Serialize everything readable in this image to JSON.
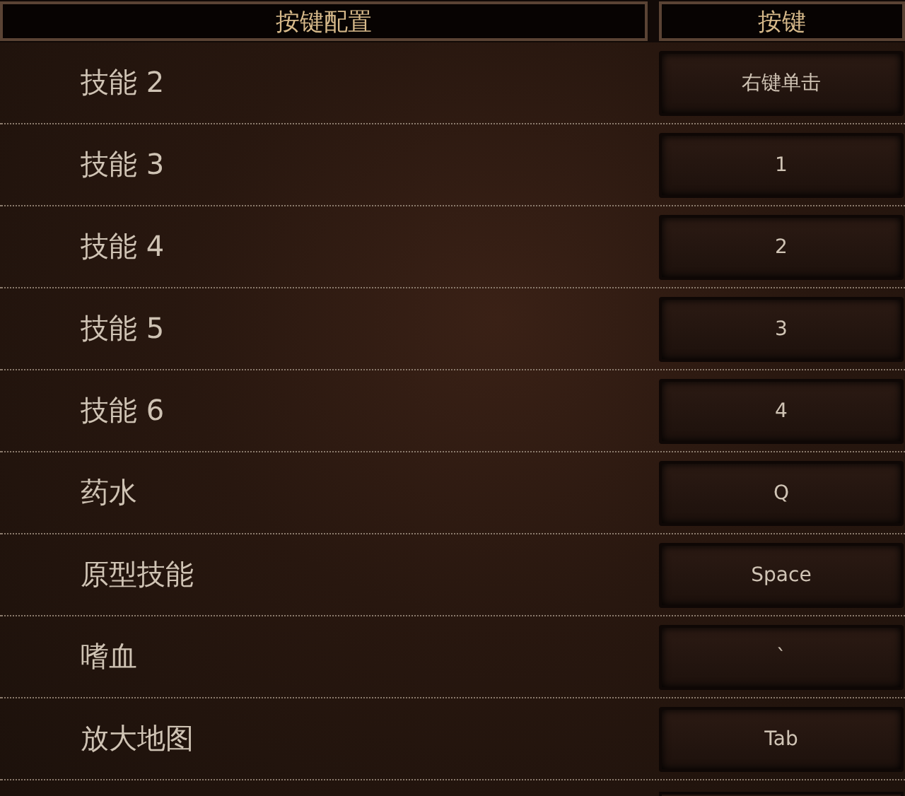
{
  "columns": [
    "按键配置",
    "按键"
  ],
  "bindings": [
    {
      "action": "技能 2",
      "key": "右键单击"
    },
    {
      "action": "技能 3",
      "key": "1"
    },
    {
      "action": "技能 4",
      "key": "2"
    },
    {
      "action": "技能 5",
      "key": "3"
    },
    {
      "action": "技能 6",
      "key": "4"
    },
    {
      "action": "药水",
      "key": "Q"
    },
    {
      "action": "原型技能",
      "key": "Space"
    },
    {
      "action": "嗜血",
      "key": "`"
    },
    {
      "action": "放大地图",
      "key": "Tab"
    }
  ]
}
